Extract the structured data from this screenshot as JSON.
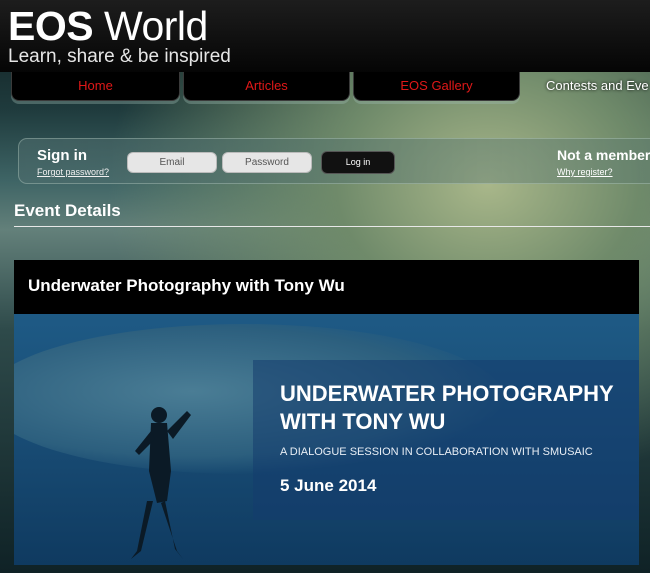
{
  "header": {
    "logo_eos": "EOS",
    "logo_world": "World",
    "tagline": "Learn, share & be inspired"
  },
  "nav": {
    "items": [
      {
        "label": "Home"
      },
      {
        "label": "Articles"
      },
      {
        "label": "EOS Gallery"
      },
      {
        "label": "Contests and Eve"
      }
    ]
  },
  "signin": {
    "title": "Sign in",
    "forgot": "Forgot password?",
    "email_placeholder": "Email",
    "password_placeholder": "Password",
    "login_label": "Log in",
    "not_member": "Not a member",
    "why_register": "Why register?"
  },
  "section": {
    "title": "Event Details"
  },
  "event": {
    "title": "Underwater Photography with Tony Wu",
    "banner_line1": "UNDERWATER PHOTOGRAPHY",
    "banner_line2": "WITH TONY WU",
    "banner_subtitle": "A DIALOGUE SESSION IN COLLABORATION WITH SMUSAIC",
    "banner_date": "5 June 2014"
  },
  "colors": {
    "nav_text": "#e01818",
    "header_bg": "#0a0a0a",
    "banner_blue": "#1e5a85"
  }
}
